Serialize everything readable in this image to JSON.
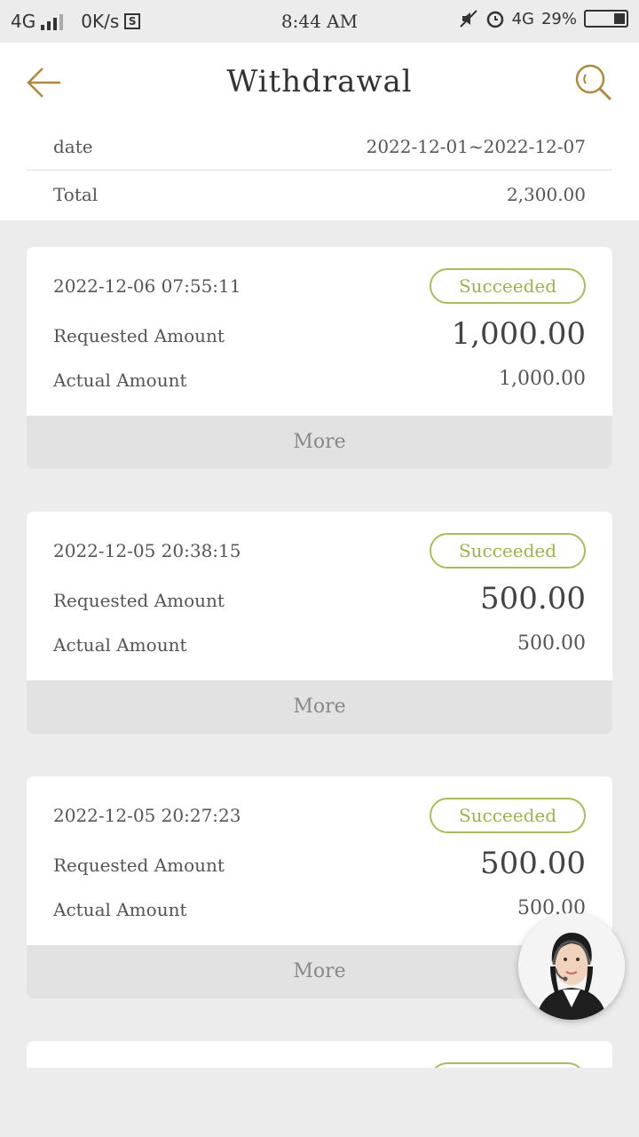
{
  "status_bar": {
    "network_left": "4G",
    "speed": "0K/s",
    "s_badge": "S",
    "time": "8:44 AM",
    "network_right": "4G",
    "battery": "29%"
  },
  "header": {
    "title": "Withdrawal",
    "back_icon": "arrow-left-icon",
    "search_icon": "search-icon",
    "accent": "#b08a3a"
  },
  "summary": {
    "date_label": "date",
    "date_value": "2022-12-01~2022-12-07",
    "total_label": "Total",
    "total_value": "2,300.00"
  },
  "records": [
    {
      "time": "2022-12-06 07:55:11",
      "status": "Succeeded",
      "requested_label": "Requested Amount",
      "requested_value": "1,000.00",
      "actual_label": "Actual Amount",
      "actual_value": "1,000.00",
      "more_label": "More"
    },
    {
      "time": "2022-12-05 20:38:15",
      "status": "Succeeded",
      "requested_label": "Requested Amount",
      "requested_value": "500.00",
      "actual_label": "Actual Amount",
      "actual_value": "500.00",
      "more_label": "More"
    },
    {
      "time": "2022-12-05 20:27:23",
      "status": "Succeeded",
      "requested_label": "Requested Amount",
      "requested_value": "500.00",
      "actual_label": "Actual Amount",
      "actual_value": "500.00",
      "more_label": "More"
    }
  ],
  "colors": {
    "status_green": "#9bb34a",
    "page_bg": "#ececec"
  }
}
